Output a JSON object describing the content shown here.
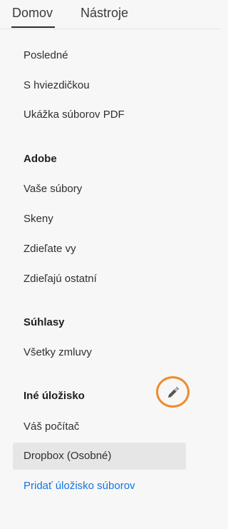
{
  "tabs": {
    "home": "Domov",
    "tools": "Nástroje"
  },
  "nav": {
    "recent": "Posledné",
    "starred": "S hviezdičkou",
    "sample_pdf": "Ukážka súborov PDF",
    "adobe_header": "Adobe",
    "your_files": "Vaše súbory",
    "scans": "Skeny",
    "shared_by_you": "Zdieľate vy",
    "shared_by_others": "Zdieľajú ostatní",
    "agreements_header": "Súhlasy",
    "all_agreements": "Všetky zmluvy",
    "other_storage_header": "Iné úložisko",
    "your_computer": "Váš počítač",
    "dropbox": "Dropbox (Osobné)",
    "add_storage": "Pridať úložisko súborov"
  },
  "icons": {
    "edit": "pencil-icon"
  },
  "colors": {
    "accent": "#1473e6",
    "highlight_ring": "#ef8b2d",
    "selected_bg": "#e6e6e6"
  }
}
